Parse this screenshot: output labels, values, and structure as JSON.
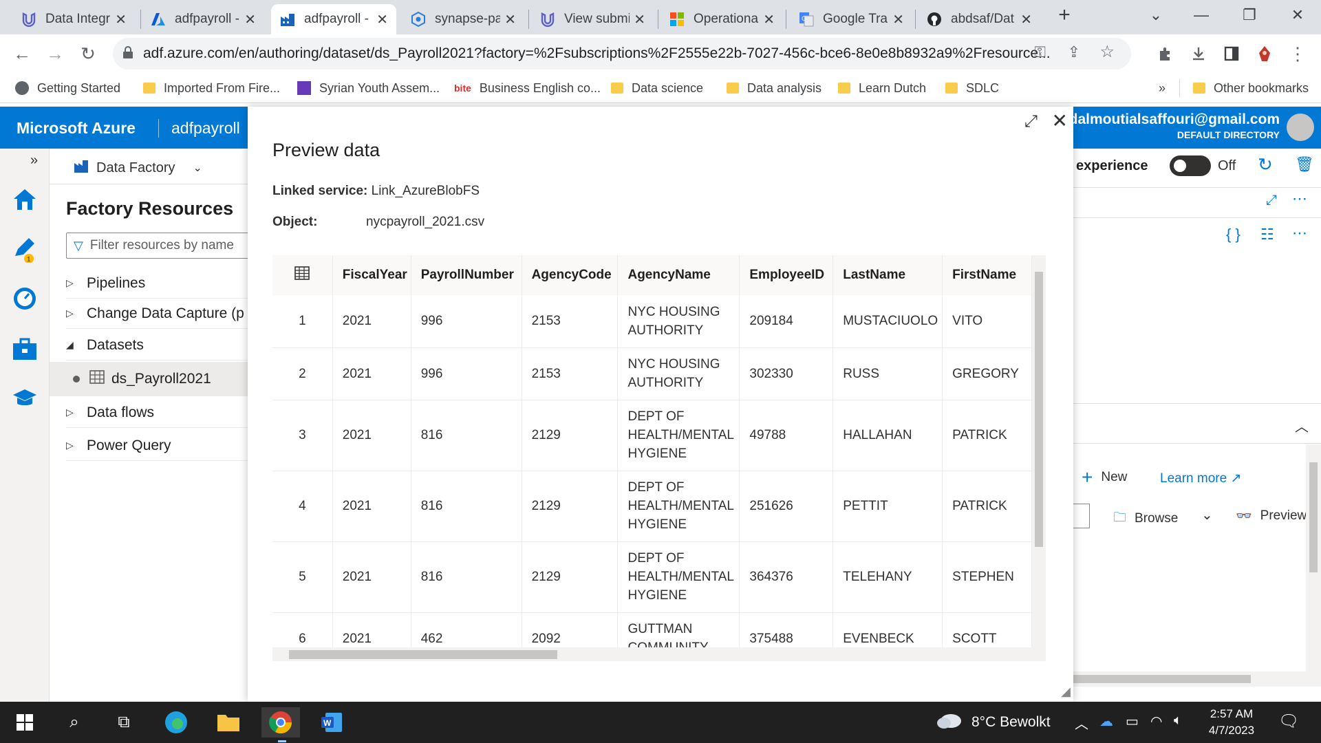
{
  "browser": {
    "tabs": [
      {
        "title": "Data Integr",
        "icon": "microsoft-learn-icon",
        "active": false
      },
      {
        "title": "adfpayroll -",
        "icon": "azure-icon",
        "active": false
      },
      {
        "title": "adfpayroll -",
        "icon": "data-factory-icon",
        "active": true
      },
      {
        "title": "synapse-pa",
        "icon": "synapse-icon",
        "active": false
      },
      {
        "title": "View submi",
        "icon": "microsoft-learn-icon",
        "active": false
      },
      {
        "title": "Operationa",
        "icon": "microsoft-icon",
        "active": false
      },
      {
        "title": "Google Trar",
        "icon": "google-translate-icon",
        "active": false
      },
      {
        "title": "abdsaf/Dat",
        "icon": "github-icon",
        "active": false
      }
    ],
    "url": "adf.azure.com/en/authoring/dataset/ds_Payroll2021?factory=%2Fsubscriptions%2F2555e22b-7027-456c-bce6-8e0e8b8932a9%2Fresource...",
    "bookmarks": [
      {
        "label": "Getting Started",
        "icon": "globe-icon"
      },
      {
        "label": "Imported From Fire...",
        "icon": "folder-icon"
      },
      {
        "label": "Syrian Youth Assem...",
        "icon": "forms-icon"
      },
      {
        "label": "Business English co...",
        "icon": "bite-icon"
      },
      {
        "label": "Data science",
        "icon": "folder-icon"
      },
      {
        "label": "Data analysis",
        "icon": "folder-icon"
      },
      {
        "label": "Learn Dutch",
        "icon": "folder-icon"
      },
      {
        "label": "SDLC",
        "icon": "folder-icon"
      }
    ],
    "bookmarks_overflow": "»",
    "other_bookmarks": "Other bookmarks"
  },
  "azure": {
    "brand": "Microsoft Azure",
    "factory": "adfpayroll",
    "user": "bedalmoutialsaffouri@gmail.com",
    "directory": "DEFAULT DIRECTORY",
    "factory_menu": "Data Factory",
    "experience_label": "experience",
    "toggle_state": "Off"
  },
  "factory_resources": {
    "title": "Factory Resources",
    "filter_placeholder": "Filter resources by name",
    "items": [
      {
        "label": "Pipelines",
        "caret": "▷"
      },
      {
        "label": "Change Data Capture (p",
        "caret": "▷"
      },
      {
        "label": "Datasets",
        "caret": "◢"
      },
      {
        "label": "ds_Payroll2021",
        "caret": ""
      },
      {
        "label": "Data flows",
        "caret": "▷"
      },
      {
        "label": "Power Query",
        "caret": "▷"
      }
    ],
    "badge": "1"
  },
  "preview": {
    "title": "Preview data",
    "linked_service_label": "Linked service:",
    "linked_service": "Link_AzureBlobFS",
    "object_label": "Object:",
    "object": "nycpayroll_2021.csv",
    "columns": [
      "FiscalYear",
      "PayrollNumber",
      "AgencyCode",
      "AgencyName",
      "EmployeeID",
      "LastName",
      "FirstName"
    ],
    "rows": [
      [
        "1",
        "2021",
        "996",
        "2153",
        "NYC HOUSING AUTHORITY",
        "209184",
        "MUSTACIUOLO",
        "VITO"
      ],
      [
        "2",
        "2021",
        "996",
        "2153",
        "NYC HOUSING AUTHORITY",
        "302330",
        "RUSS",
        "GREGORY"
      ],
      [
        "3",
        "2021",
        "816",
        "2129",
        "DEPT OF HEALTH/MENTAL HYGIENE",
        "49788",
        "HALLAHAN",
        "PATRICK"
      ],
      [
        "4",
        "2021",
        "816",
        "2129",
        "DEPT OF HEALTH/MENTAL HYGIENE",
        "251626",
        "PETTIT",
        "PATRICK"
      ],
      [
        "5",
        "2021",
        "816",
        "2129",
        "DEPT OF HEALTH/MENTAL HYGIENE",
        "364376",
        "TELEHANY",
        "STEPHEN"
      ],
      [
        "6",
        "2021",
        "462",
        "2092",
        "GUTTMAN COMMUNITY",
        "375488",
        "EVENBECK",
        "SCOTT"
      ]
    ]
  },
  "right_panel": {
    "new_label": "New",
    "learn_more": "Learn more",
    "browse": "Browse",
    "preview": "Preview"
  },
  "taskbar": {
    "weather": "8°C  Bewolkt",
    "time": "2:57 AM",
    "date": "4/7/2023"
  },
  "colors": {
    "azure_blue": "#0078d4",
    "taskbar": "#202020"
  }
}
